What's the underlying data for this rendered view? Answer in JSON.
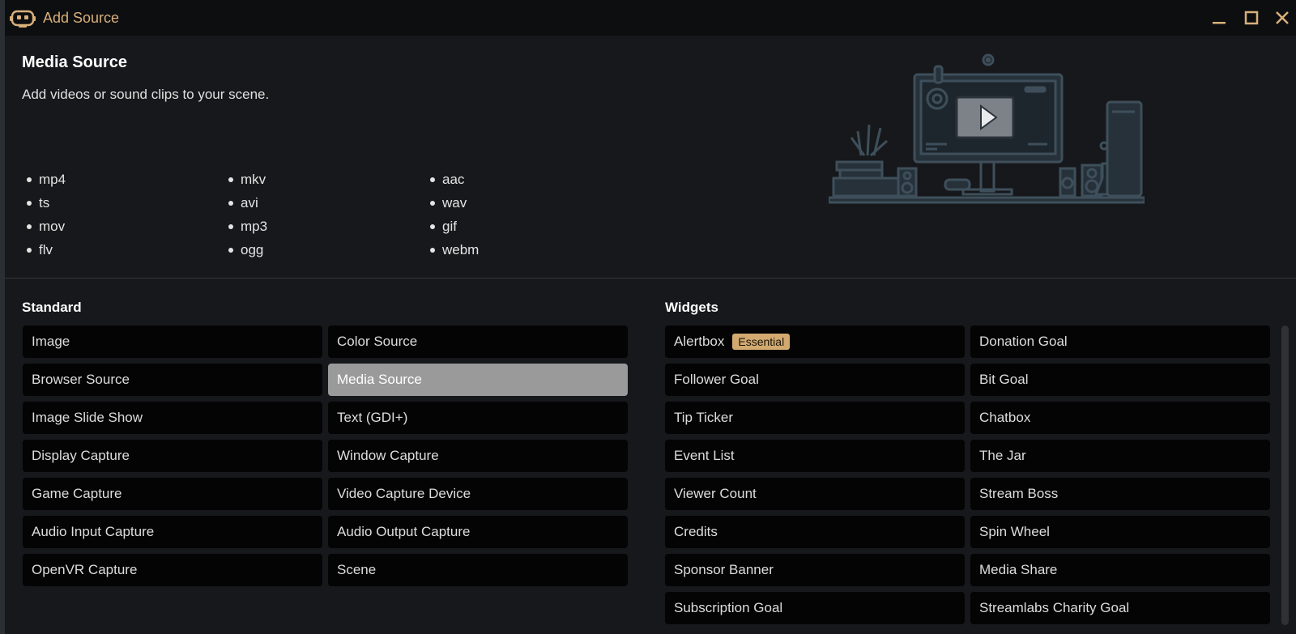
{
  "window": {
    "title": "Add Source"
  },
  "info": {
    "title": "Media Source",
    "description": "Add videos or sound clips to your scene.",
    "formats": [
      "mp4",
      "ts",
      "mov",
      "flv",
      "mkv",
      "avi",
      "mp3",
      "ogg",
      "aac",
      "wav",
      "gif",
      "webm"
    ]
  },
  "sections": {
    "standard_label": "Standard",
    "widgets_label": "Widgets"
  },
  "standard": [
    "Image",
    "Color Source",
    "Browser Source",
    "Media Source",
    "Image Slide Show",
    "Text (GDI+)",
    "Display Capture",
    "Window Capture",
    "Game Capture",
    "Video Capture Device",
    "Audio Input Capture",
    "Audio Output Capture",
    "OpenVR Capture",
    "Scene"
  ],
  "standard_selected": "Media Source",
  "widgets": [
    "Alertbox",
    "Donation Goal",
    "Follower Goal",
    "Bit Goal",
    "Tip Ticker",
    "Chatbox",
    "Event List",
    "The Jar",
    "Viewer Count",
    "Stream Boss",
    "Credits",
    "Spin Wheel",
    "Sponsor Banner",
    "Media Share",
    "Subscription Goal",
    "Streamlabs Charity Goal"
  ],
  "alertbox_badge": "Essential",
  "colors": {
    "accent": "#d9b07a",
    "badge": "#d2aa70",
    "selected": "#9a9a9a",
    "item_bg": "#040405",
    "panel_bg": "#17181b"
  },
  "icons": {
    "app": "streamlabs-robot-icon",
    "minimize": "minimize-icon",
    "maximize": "maximize-icon",
    "close": "close-icon",
    "illustration": "media-desk-illustration"
  }
}
